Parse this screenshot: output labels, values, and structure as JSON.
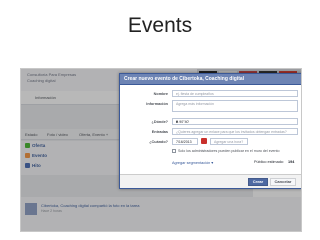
{
  "slide": {
    "title": "Events"
  },
  "background_page": {
    "top_line1": "Consultoría Para Empresas",
    "top_line2": "Coaching digital",
    "info_tab": "Información",
    "tabs": [
      "Estado",
      "Foto / video",
      "Oferta, Evento +"
    ],
    "side_items": [
      "Oferta",
      "Evento",
      "Hito"
    ],
    "post_text": "Cibertoka, Coaching digital compartió la foto en la tarea",
    "post_sub": "Hace 2 horas"
  },
  "dialog": {
    "title": "Crear nuevo evento de Cibertoka, Coaching digital",
    "labels": {
      "name": "Nombre",
      "details": "Información",
      "where": "¿Dónde?",
      "tickets": "Entradas",
      "when": "¿Cuándo?"
    },
    "name_placeholder": "ej. fiesta de cumpleaños",
    "details_placeholder": "Agrega más información",
    "where_value": "B 90°40'",
    "tickets_placeholder": "¿Quieres agregar un enlace para que los invitados obtengan entradas?",
    "date_value": "7/16/2013",
    "time_placeholder": "Agregar una hora?",
    "admin_only_label": "Solo los administradores pueden publicar en el muro del evento",
    "add_target_link": "Agregar segmentación ▾",
    "public_label": "Público estimado:",
    "public_value": "194",
    "create_button": "Crear",
    "cancel_button": "Cancelar"
  },
  "colors": {
    "dialog_header": "#6d84b4",
    "primary_button": "#4e69a2",
    "link": "#365899"
  }
}
